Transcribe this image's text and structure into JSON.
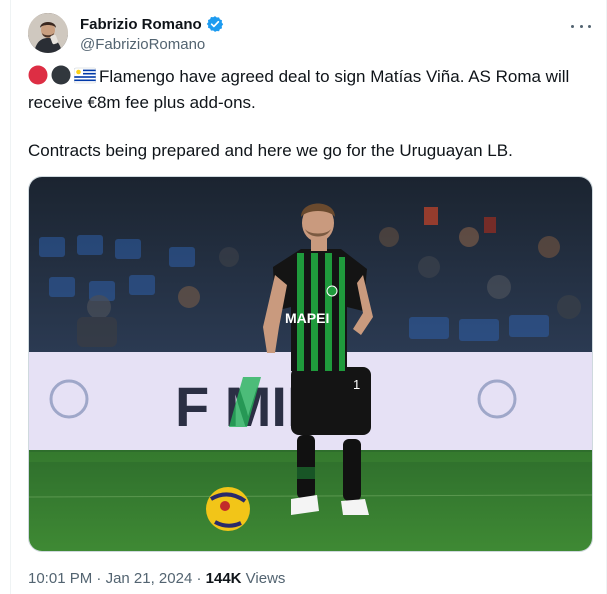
{
  "author": {
    "display_name": "Fabrizio Romano",
    "handle": "@FabrizioRomano"
  },
  "tweet": {
    "line1": "Flamengo have agreed deal to sign Matías Viña. AS Roma will",
    "line2": "receive €8m fee plus add-ons.",
    "line3": "Contracts being prepared and here we go for the Uruguayan LB.",
    "emojis": [
      "red-circle-icon",
      "black-circle-icon",
      "uruguay-flag-icon"
    ]
  },
  "media": {
    "ad_board_text": "F   MIM",
    "shirt_sponsor": "MAPEI",
    "colors": {
      "pitch": "#2f7a2c",
      "board": "#e8e4f6",
      "kit_green": "#1f9a3c",
      "kit_black": "#111111"
    }
  },
  "meta": {
    "time": "10:01 PM",
    "separator1": " · ",
    "date": "Jan 21, 2024",
    "separator2": " · ",
    "views_count": "144K",
    "views_label": " Views"
  },
  "colors": {
    "verified": "#1d9bf0",
    "secondary_text": "#536471"
  }
}
